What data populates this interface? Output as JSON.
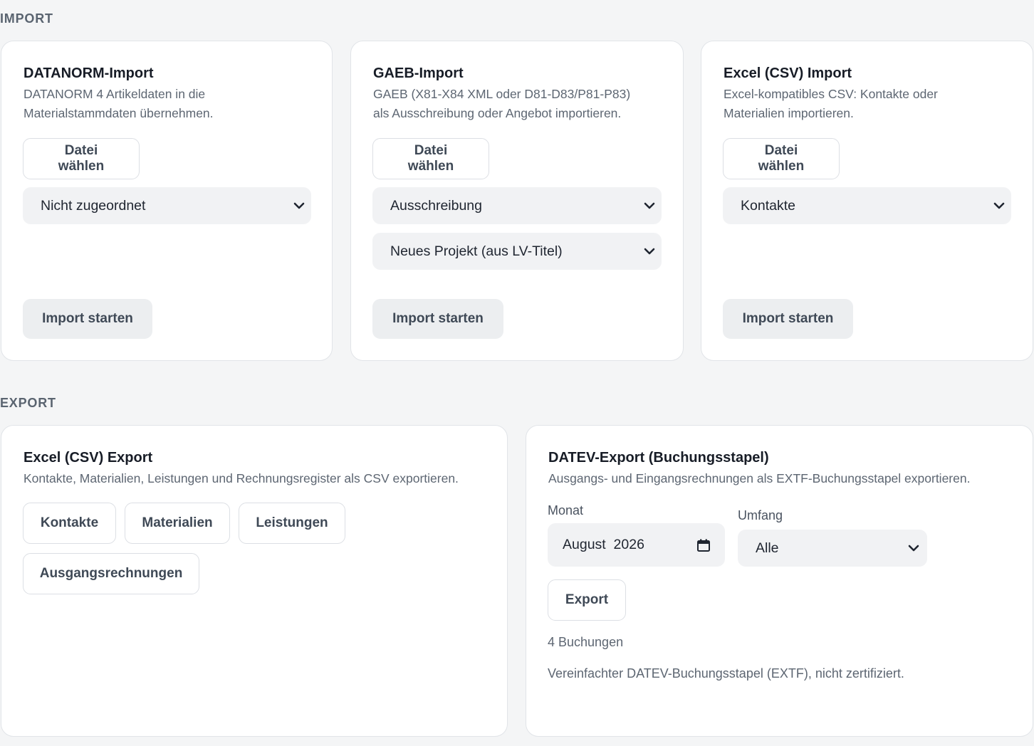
{
  "import": {
    "section_label": "IMPORT",
    "cards": [
      {
        "title": "DATANORM-Import",
        "desc_line1": "DATANORM 4 Artikeldaten in die",
        "desc_line2": "Materialstammdaten übernehmen.",
        "file_button": "Datei wählen",
        "select1": "Nicht zugeordnet",
        "start_button": "Import starten"
      },
      {
        "title": "GAEB-Import",
        "desc_line1": "GAEB (X81-X84 XML oder D81-D83/P81-P83)",
        "desc_line2": "als Ausschreibung oder Angebot importieren.",
        "file_button": "Datei wählen",
        "select1": "Ausschreibung",
        "select2": "Neues Projekt (aus LV-Titel)",
        "start_button": "Import starten"
      },
      {
        "title": "Excel (CSV) Import",
        "desc_line1": "Excel-kompatibles CSV: Kontakte oder",
        "desc_line2": "Materialien importieren.",
        "file_button": "Datei wählen",
        "select1": "Kontakte",
        "start_button": "Import starten"
      }
    ]
  },
  "export": {
    "section_label": "EXPORT",
    "csv": {
      "title": "Excel (CSV) Export",
      "desc": "Kontakte, Materialien, Leistungen und Rechnungsregister als CSV exportieren.",
      "buttons": [
        "Kontakte",
        "Materialien",
        "Leistungen",
        "Ausgangsrechnungen"
      ]
    },
    "datev": {
      "title": "DATEV-Export (Buchungsstapel)",
      "desc": "Ausgangs- und Eingangsrechnungen als EXTF-Buchungsstapel exportieren.",
      "month_label": "Monat",
      "month_value": "August  2026",
      "scope_label": "Umfang",
      "scope_value": "Alle",
      "export_button": "Export",
      "count": "4 Buchungen",
      "note": "Vereinfachter DATEV-Buchungsstapel (EXTF), nicht zertifiziert."
    }
  },
  "icons": {
    "chevron": "chevron-down-icon",
    "calendar": "calendar-icon"
  }
}
